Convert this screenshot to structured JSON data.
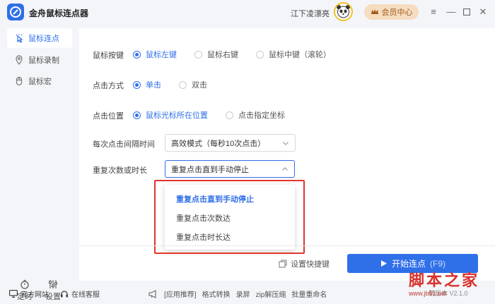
{
  "app": {
    "title": "金舟鼠标连点器"
  },
  "header": {
    "username": "江下凌漂亮",
    "vip_label": "会员中心",
    "window_buttons": [
      "menu-icon",
      "minimize-icon",
      "maximize-icon",
      "close-icon"
    ]
  },
  "sidebar": {
    "items": [
      {
        "label": "鼠标连点",
        "icon": "mouse-click-icon",
        "active": true
      },
      {
        "label": "鼠标录制",
        "icon": "location-pin-icon",
        "active": false
      },
      {
        "label": "鼠标宏",
        "icon": "mouse-icon",
        "active": false
      }
    ],
    "tools": [
      {
        "label": "定时",
        "icon": "timer-icon"
      },
      {
        "label": "设置",
        "icon": "sliders-icon"
      }
    ]
  },
  "form": {
    "mouse_button": {
      "label": "鼠标按键",
      "options": [
        "鼠标左键",
        "鼠标右键",
        "鼠标中键（滚轮）"
      ],
      "selected": "鼠标左键"
    },
    "click_mode": {
      "label": "点击方式",
      "options": [
        "单击",
        "双击"
      ],
      "selected": "单击"
    },
    "click_position": {
      "label": "点击位置",
      "options": [
        "鼠标光标所在位置",
        "点击指定坐标"
      ],
      "selected": "鼠标光标所在位置"
    },
    "interval": {
      "label": "每次点击间隔时间",
      "value": "高效模式（每秒10次点击）"
    },
    "repeat": {
      "label": "重复次数或时长",
      "value": "重复点击直到手动停止",
      "options": [
        "重复点击直到手动停止",
        "重复点击次数达",
        "重复点击时长达"
      ]
    }
  },
  "actions": {
    "shortcut_label": "设置快捷键",
    "start_label": "开始连点",
    "start_key": "(F9)"
  },
  "footer": {
    "website": "官方网站",
    "support": "在线客服",
    "tools": [
      "[应用推荐]",
      "格式转换",
      "录屏",
      "zip解压缩",
      "批量重命名"
    ],
    "version_label": "新版本 V2.1.0"
  },
  "watermark": {
    "main": "脚本之家",
    "url": "www.jb51.net"
  },
  "colors": {
    "accent": "#2f6fe8",
    "highlight": "#e2342c",
    "vip_bg": "#f6dcc0"
  }
}
